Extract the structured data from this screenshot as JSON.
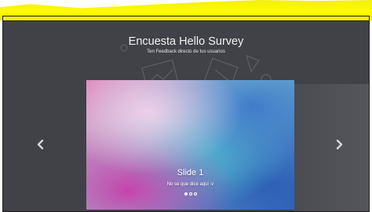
{
  "page": {
    "title": "Encuesta Hello Survey",
    "subtitle": "Ten Feedback directo de tus usuarios"
  },
  "carousel": {
    "slides": [
      {
        "caption": "Slide 1",
        "text": "No se que dice aqui :v"
      }
    ],
    "active_index": 0,
    "indicator_count": 3,
    "prev_icon": "chevron-left-icon",
    "next_icon": "chevron-right-icon"
  },
  "colors": {
    "background": "#414247",
    "highlight": "#f7f400",
    "text": "#f2f2f2"
  }
}
